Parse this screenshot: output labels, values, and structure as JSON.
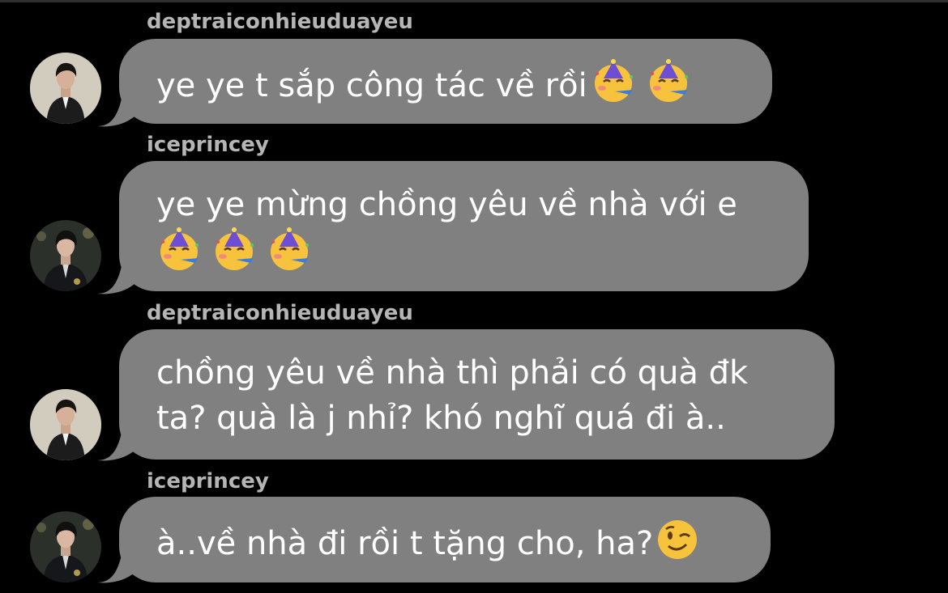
{
  "messages": [
    {
      "sender": "deptraiconhieuduayeu",
      "lines": [
        "ye ye t sắp công tác về rồi"
      ],
      "emoji_line": 0,
      "emojis": [
        "partying-face",
        "partying-face"
      ]
    },
    {
      "sender": "iceprincey",
      "lines": [
        "ye ye mừng chồng yêu về nhà với e",
        ""
      ],
      "emoji_line": 1,
      "emojis": [
        "partying-face",
        "partying-face",
        "partying-face"
      ]
    },
    {
      "sender": "deptraiconhieuduayeu",
      "lines": [
        "chồng yêu về nhà thì phải có quà đk",
        "ta? quà là j nhỉ? khó nghĩ quá đi à.."
      ],
      "emoji_line": null,
      "emojis": []
    },
    {
      "sender": "iceprincey",
      "lines": [
        "à..về nhà đi rồi t tặng cho, ha?"
      ],
      "emoji_line": 0,
      "emojis": [
        "winking-face"
      ]
    }
  ],
  "colors": {
    "background": "#000000",
    "bubble": "#808080",
    "sender_text": "#b5b5b5",
    "message_text": "#ffffff"
  }
}
